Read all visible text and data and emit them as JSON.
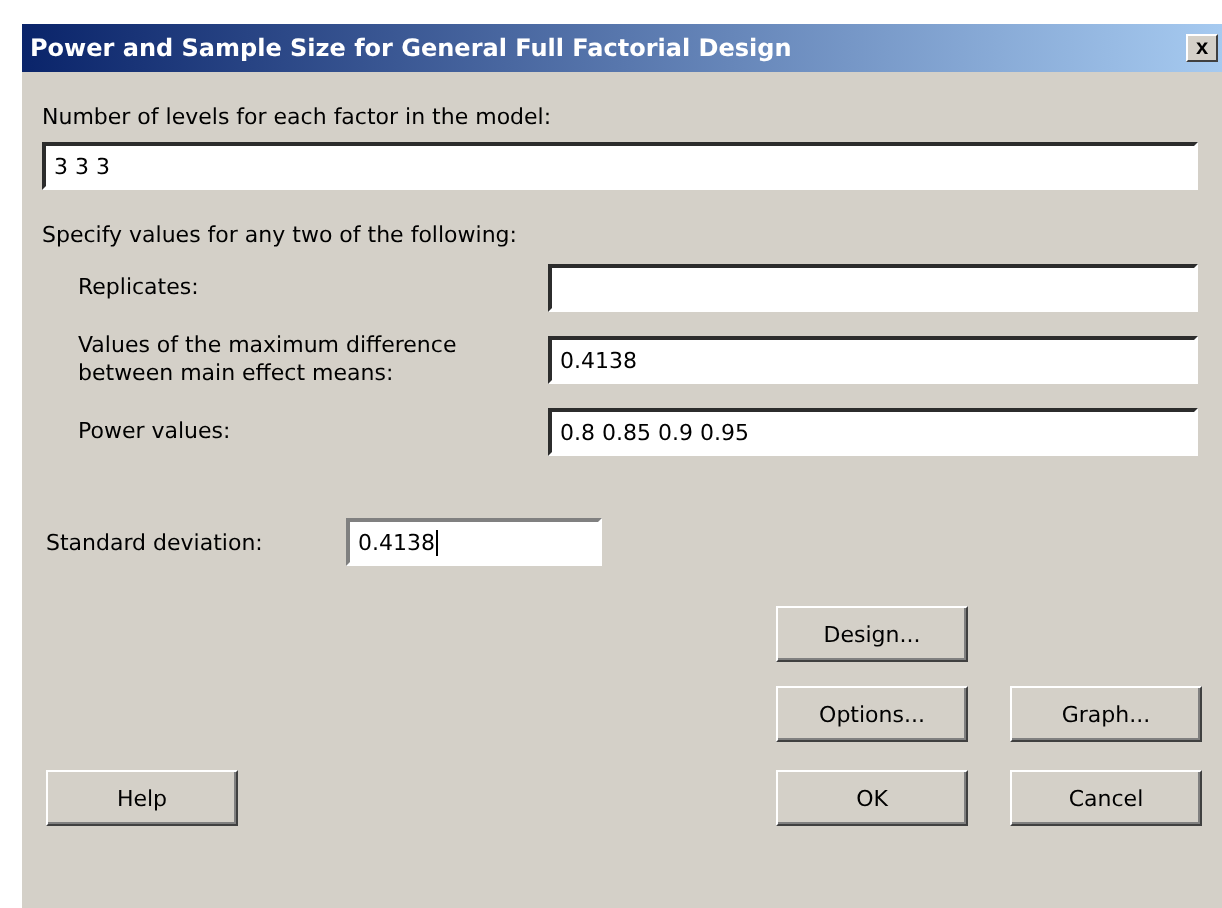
{
  "window": {
    "title": "Power and Sample Size for General Full Factorial Design",
    "close": "x"
  },
  "levels": {
    "label": "Number of levels for each factor in the model:",
    "value": "3 3 3"
  },
  "specify": {
    "label": "Specify values for any two of the following:",
    "fields": [
      {
        "label": "Replicates:"
      },
      {
        "label": "Values of the maximum difference between main effect means:",
        "value": "0.4138"
      },
      {
        "label": "Power values:",
        "value": "0.8 0.85 0.9 0.95"
      }
    ]
  },
  "std_dev": {
    "label": "Standard deviation:",
    "value": "0.4138",
    "focused": true
  },
  "buttons": {
    "design": "Design...",
    "options": "Options...",
    "graph": "Graph...",
    "help": "Help",
    "ok": "OK",
    "cancel": "Cancel"
  }
}
